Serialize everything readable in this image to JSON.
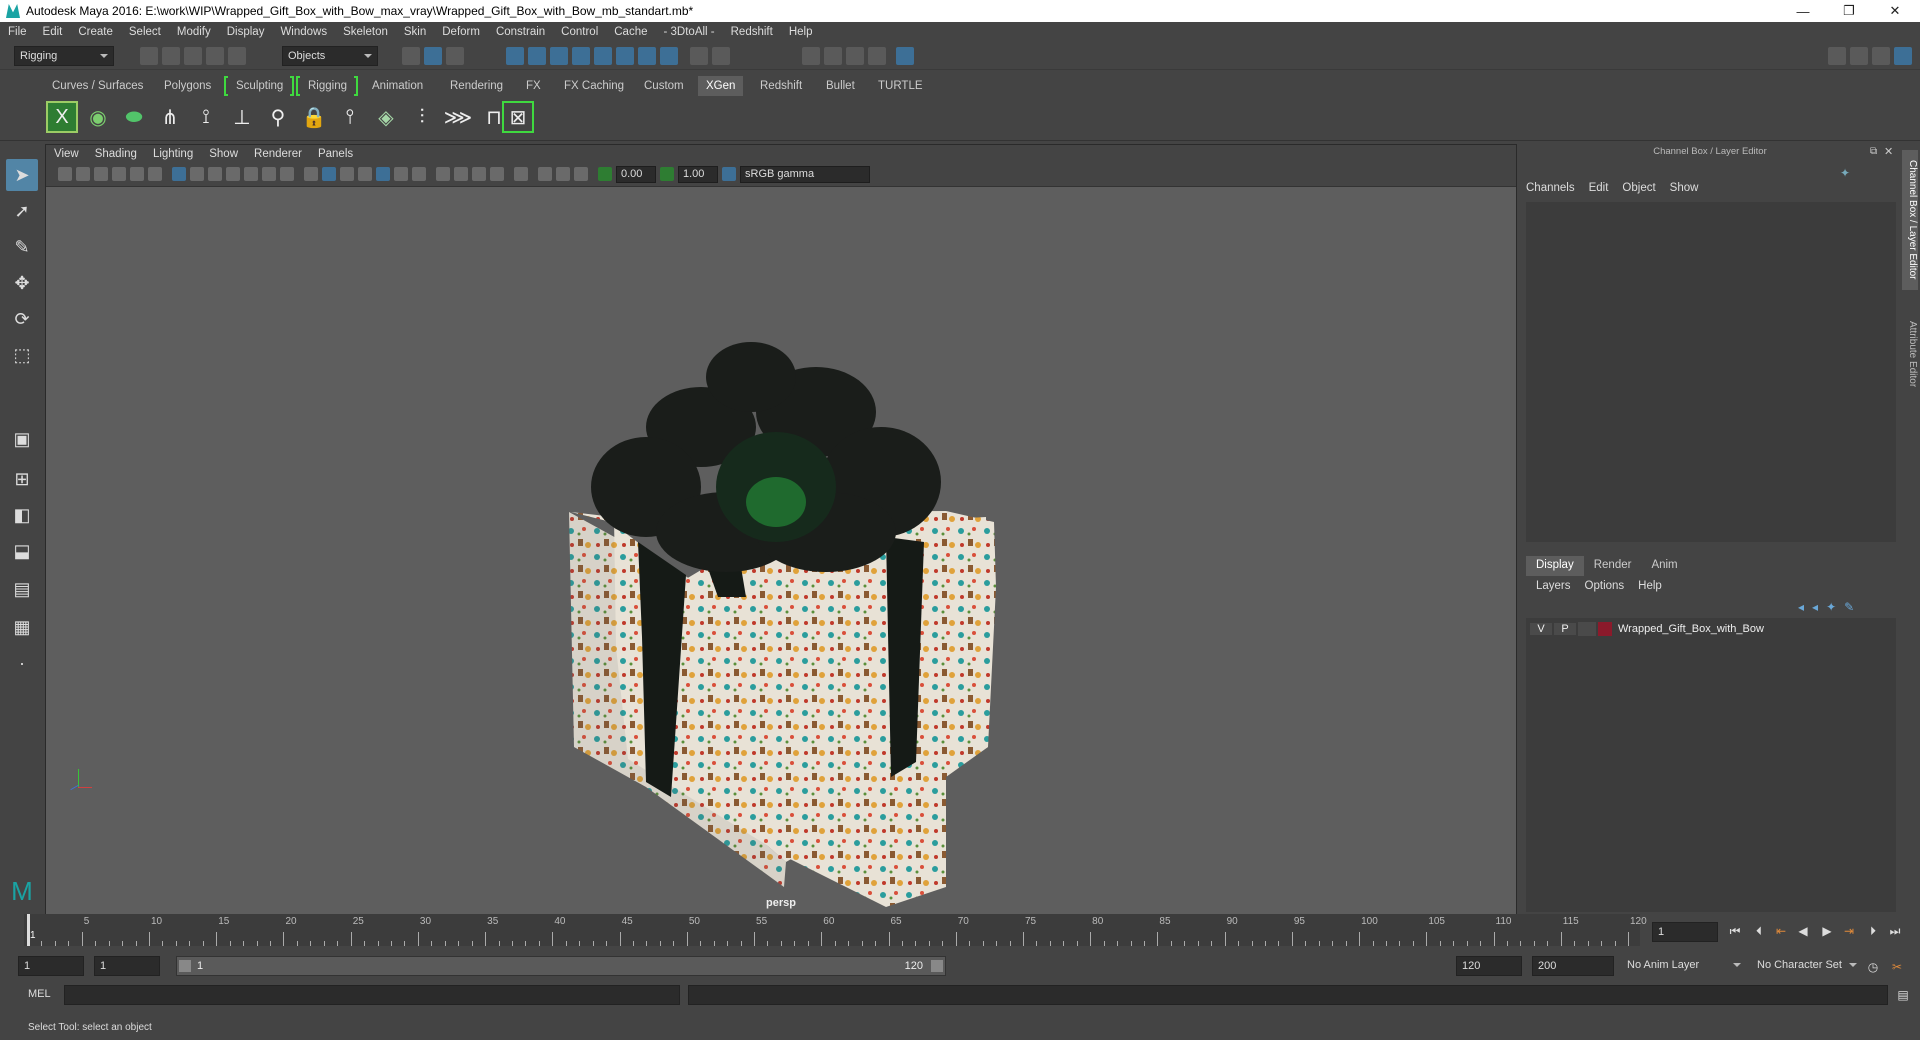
{
  "window": {
    "title": "Autodesk Maya 2016: E:\\work\\WIP\\Wrapped_Gift_Box_with_Bow_max_vray\\Wrapped_Gift_Box_with_Bow_mb_standart.mb*"
  },
  "menubar": [
    "File",
    "Edit",
    "Create",
    "Select",
    "Modify",
    "Display",
    "Windows",
    "Skeleton",
    "Skin",
    "Deform",
    "Constrain",
    "Control",
    "Cache",
    "- 3DtoAll -",
    "Redshift",
    "Help"
  ],
  "status": {
    "menuset": "Rigging",
    "select_mode": "Objects"
  },
  "shelf_tabs": [
    "Curves / Surfaces",
    "Polygons",
    "Sculpting",
    "Rigging",
    "Animation",
    "Rendering",
    "FX",
    "FX Caching",
    "Custom",
    "XGen",
    "Redshift",
    "Bullet",
    "TURTLE"
  ],
  "shelf_active": "XGen",
  "viewport": {
    "menu": [
      "View",
      "Shading",
      "Lighting",
      "Show",
      "Renderer",
      "Panels"
    ],
    "exposure": "0.00",
    "gamma": "1.00",
    "color_space": "sRGB gamma",
    "camera_label": "persp"
  },
  "channel_box": {
    "title": "Channel Box / Layer Editor",
    "menu": [
      "Channels",
      "Edit",
      "Object",
      "Show"
    ],
    "layer_tabs": [
      "Display",
      "Render",
      "Anim"
    ],
    "layer_menu": [
      "Layers",
      "Options",
      "Help"
    ],
    "layer": {
      "v": "V",
      "p": "P",
      "name": "Wrapped_Gift_Box_with_Bow",
      "color": "#8b1a2b"
    }
  },
  "side_tabs": [
    "Channel Box / Layer Editor",
    "Attribute Editor"
  ],
  "timeline": {
    "labels": [
      "1",
      "5",
      "10",
      "15",
      "20",
      "25",
      "30",
      "35",
      "40",
      "45",
      "50",
      "55",
      "60",
      "65",
      "70",
      "75",
      "80",
      "85",
      "90",
      "95",
      "100",
      "105",
      "110",
      "115",
      "120"
    ],
    "current_frame": "1"
  },
  "range": {
    "start": "1",
    "playback_start": "1",
    "slider_start": "1",
    "slider_end": "120",
    "playback_end": "120",
    "end": "200",
    "anim_layer": "No Anim Layer",
    "char_set": "No Character Set"
  },
  "cmdline": {
    "label": "MEL"
  },
  "help_line": "Select Tool: select an object",
  "colors": {
    "accent": "#5285a6",
    "shelf_bracket": "#3fd93f",
    "viewport_bg": "#5e5e5e"
  }
}
